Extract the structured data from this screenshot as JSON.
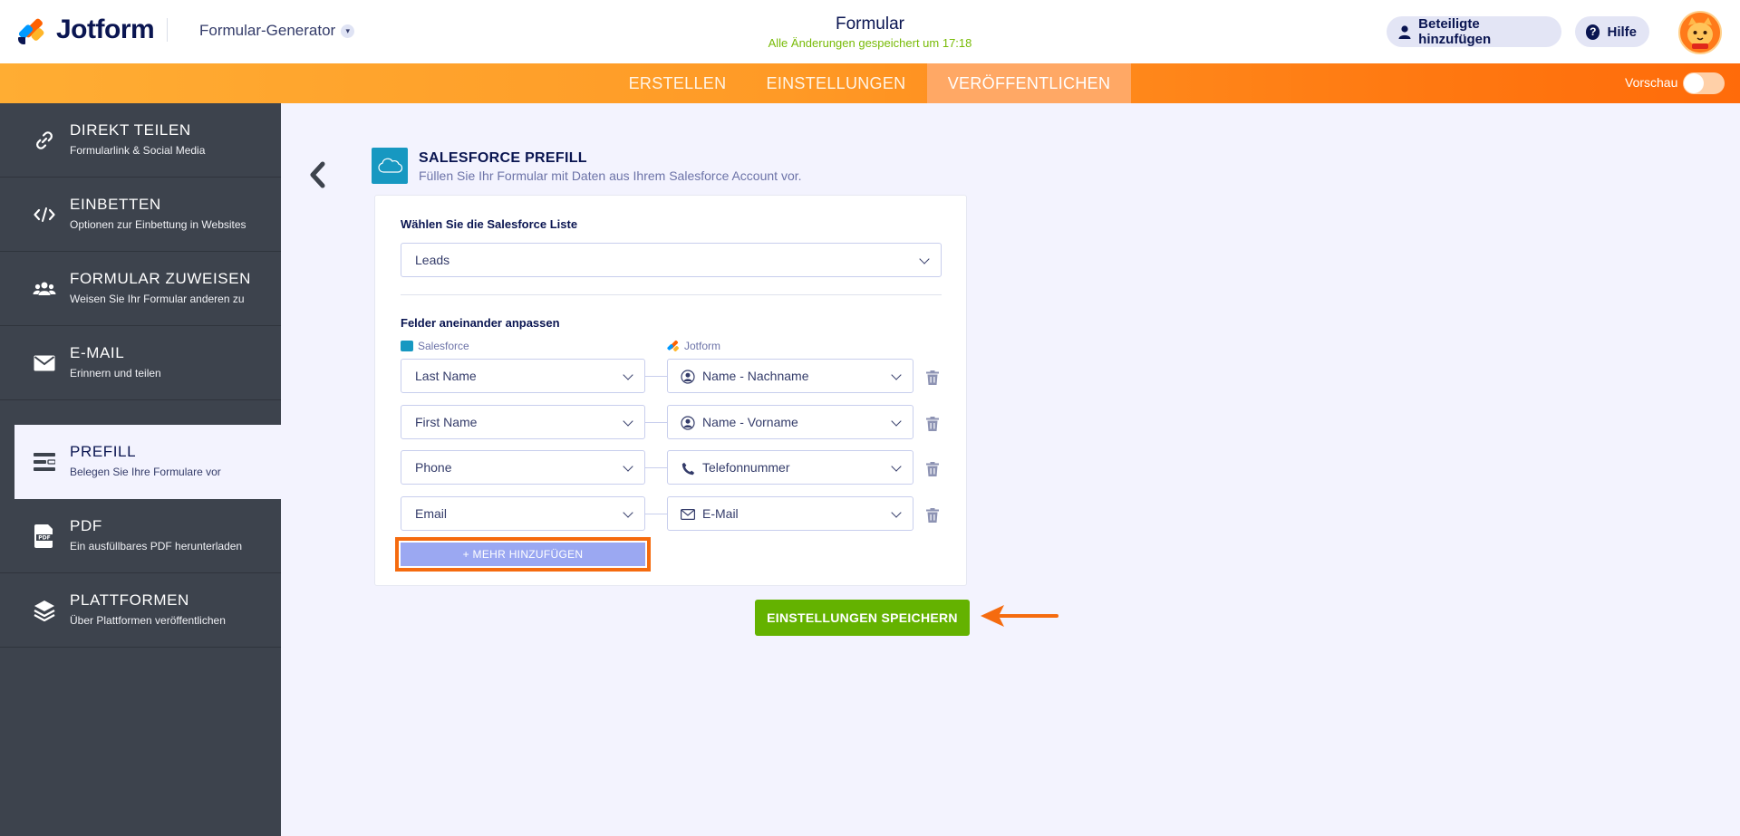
{
  "header": {
    "brand": "Jotform",
    "builder_menu": "Formular-Generator",
    "form_title": "Formular",
    "saved_status": "Alle Änderungen gespeichert um 17:18",
    "invite_label": "Beteiligte hinzufügen",
    "help_label": "Hilfe"
  },
  "nav": {
    "tabs": [
      {
        "label": "ERSTELLEN"
      },
      {
        "label": "EINSTELLUNGEN"
      },
      {
        "label": "VERÖFFENTLICHEN"
      }
    ],
    "preview_label": "Vorschau"
  },
  "sidebar": {
    "items": [
      {
        "title": "DIREKT TEILEN",
        "subtitle": "Formularlink & Social Media"
      },
      {
        "title": "EINBETTEN",
        "subtitle": "Optionen zur Einbettung in Websites"
      },
      {
        "title": "FORMULAR ZUWEISEN",
        "subtitle": "Weisen Sie Ihr Formular anderen zu"
      },
      {
        "title": "E-MAIL",
        "subtitle": "Erinnern und teilen"
      },
      {
        "title": "PREFILL",
        "subtitle": "Belegen Sie Ihre Formulare vor"
      },
      {
        "title": "PDF",
        "subtitle": "Ein ausfüllbares PDF herunterladen"
      },
      {
        "title": "PLATTFORMEN",
        "subtitle": "Über Plattformen veröffentlichen"
      }
    ]
  },
  "main": {
    "title": "SALESFORCE PREFILL",
    "subtitle": "Füllen Sie Ihr Formular mit Daten aus Ihrem Salesforce Account vor.",
    "list_label": "Wählen Sie die Salesforce Liste",
    "list_value": "Leads",
    "match_label": "Felder aneinander anpassen",
    "col_salesforce": "Salesforce",
    "col_jotform": "Jotform",
    "pdf_icon_text": "PDF",
    "mappings": [
      {
        "salesforce": "Last Name",
        "jotform": "Name - Nachname",
        "icon": "user-circle-icon"
      },
      {
        "salesforce": "First Name",
        "jotform": "Name - Vorname",
        "icon": "user-circle-icon"
      },
      {
        "salesforce": "Phone",
        "jotform": "Telefonnummer",
        "icon": "phone-icon"
      },
      {
        "salesforce": "Email",
        "jotform": "E-Mail",
        "icon": "envelope-icon"
      }
    ],
    "add_more_label": "+ MEHR HINZUFÜGEN",
    "save_label": "EINSTELLUNGEN SPEICHERN"
  },
  "colors": {
    "accent_orange": "#ff6100",
    "save_green": "#64b200",
    "sidebar_dark": "#3d434d",
    "add_more_blue": "#9ba8f2",
    "highlight_orange": "#f56b0f"
  }
}
